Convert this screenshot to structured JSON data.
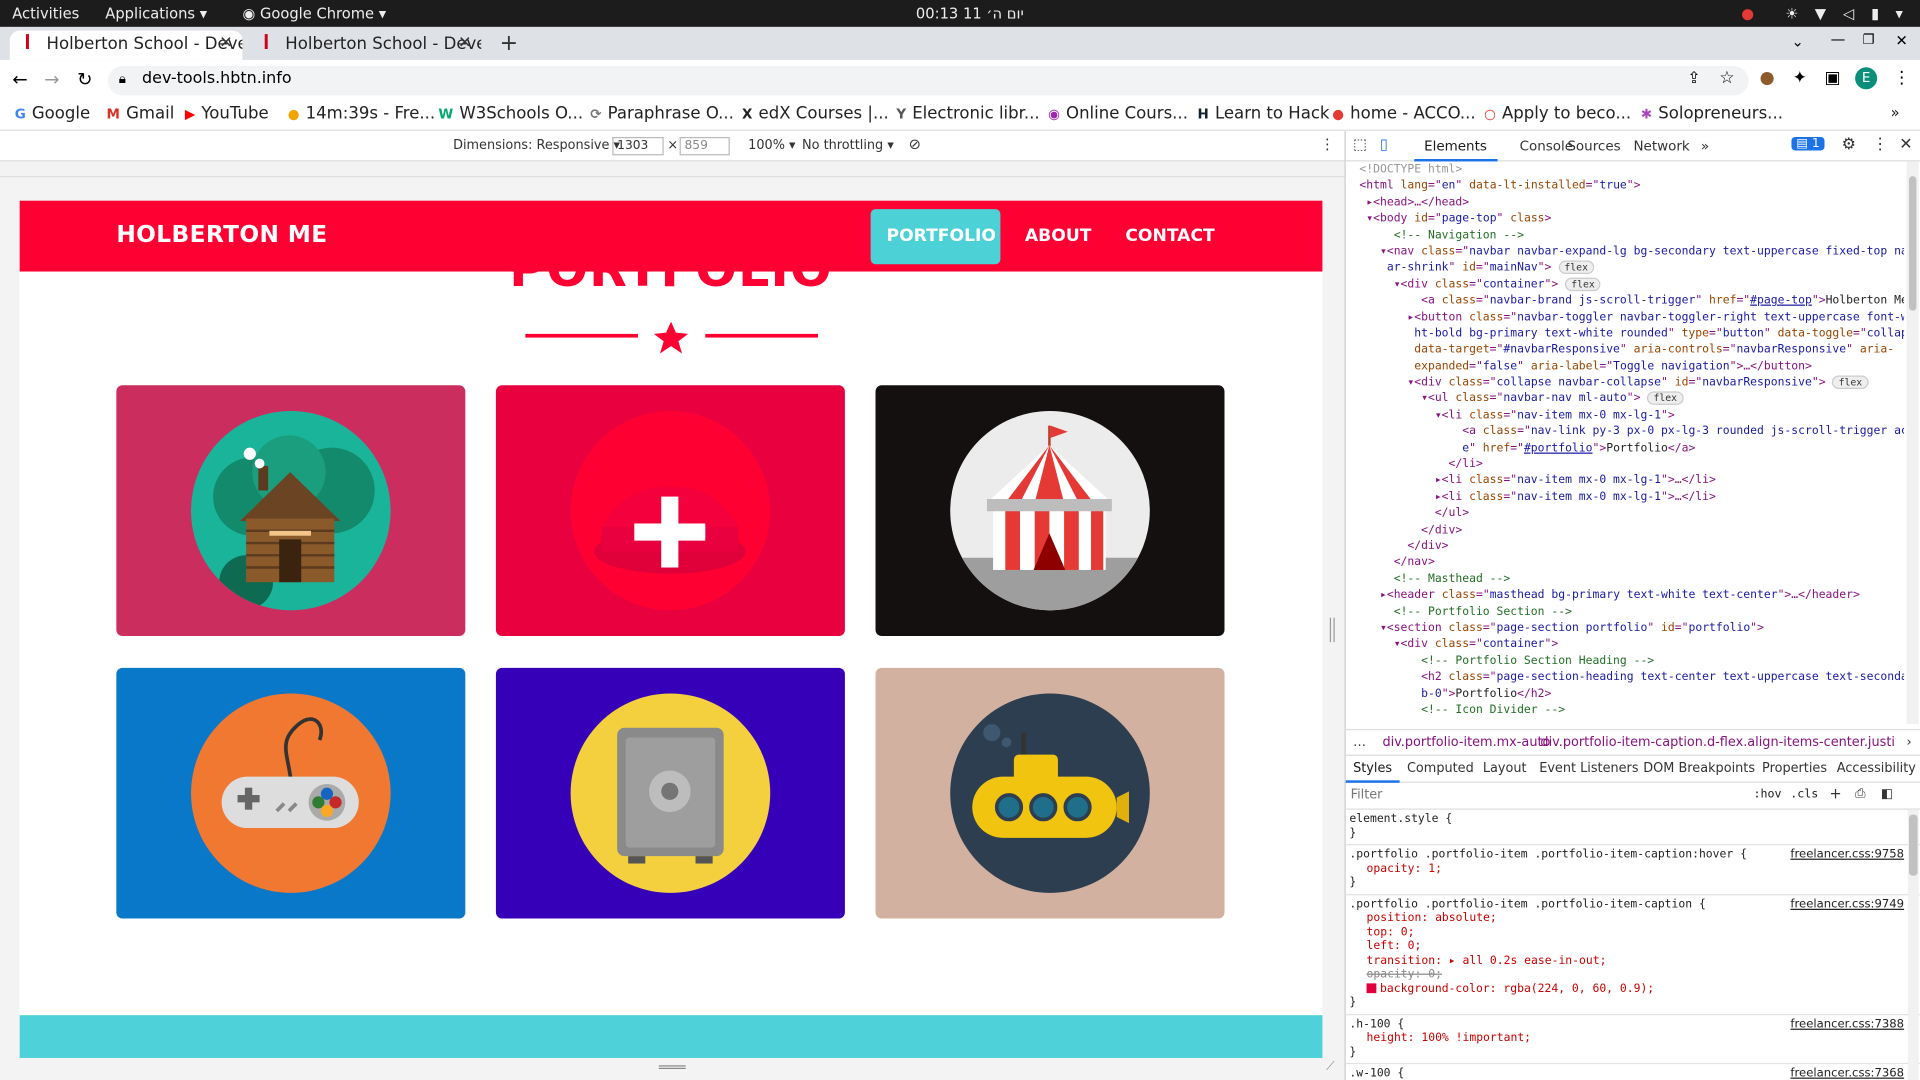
{
  "system_bar": {
    "activities": "Activities",
    "applications": "Applications",
    "browser_app": "Google Chrome",
    "clock": "יום ה׳ 11 00:13"
  },
  "browser": {
    "tabs": [
      {
        "title": "Holberton School - Deve"
      },
      {
        "title": "Holberton School - Deve"
      }
    ],
    "url": "dev-tools.hbtn.info",
    "profile_initial": "E",
    "bookmarks": [
      "Google",
      "Gmail",
      "YouTube",
      "14m:39s - Fre...",
      "W3Schools O...",
      "Paraphrase O...",
      "edX Courses |...",
      "Electronic libr...",
      "Online Cours...",
      "Learn to Hack",
      "home - ACCO...",
      "Apply to beco...",
      "Solopreneurs..."
    ]
  },
  "device_toolbar": {
    "dimensions": "Dimensions: Responsive",
    "width": "1303",
    "height": "859",
    "zoom": "100%",
    "throttling": "No throttling"
  },
  "site": {
    "brand": "HOLBERTON ME",
    "nav": [
      "PORTFOLIO",
      "ABOUT",
      "CONTACT"
    ],
    "active_nav": "PORTFOLIO",
    "section_title": "PORTFOLIO",
    "colors": {
      "primary": "#ff0033",
      "secondary": "#4cd1d6"
    },
    "portfolio": [
      {
        "icon": "cabin-icon",
        "bg": "#cc2d5f",
        "circle": "#19b49a"
      },
      {
        "icon": "cake-icon",
        "bg": "#e8003f",
        "circle": "#ff0033"
      },
      {
        "icon": "circus-tent-icon",
        "bg": "#141010",
        "circle": "#ececec"
      },
      {
        "icon": "game-controller-icon",
        "bg": "#0a78c8",
        "circle": "#f07830"
      },
      {
        "icon": "safe-icon",
        "bg": "#3600b8",
        "circle": "#f4d03f"
      },
      {
        "icon": "submarine-icon",
        "bg": "#d2b1a1",
        "circle": "#2c3e50"
      }
    ]
  },
  "devtools": {
    "tabs": [
      "Elements",
      "Console",
      "Sources",
      "Network"
    ],
    "issues_count": "1",
    "breadcrumbs": [
      "div.portfolio-item.mx-auto",
      "div.portfolio-item-caption.d-flex.align-items-center.justify-conter"
    ],
    "style_tabs": [
      "Styles",
      "Computed",
      "Layout",
      "Event Listeners",
      "DOM Breakpoints",
      "Properties",
      "Accessibility"
    ],
    "filter_placeholder": "Filter",
    "filter_hov": ":hov",
    "filter_cls": ".cls",
    "styles": {
      "element_style": "element.style {",
      "rule1_selector": ".portfolio .portfolio-item .portfolio-item-caption:hover {",
      "rule1_source": "freelancer.css:9758",
      "rule1_decl": "opacity: 1;",
      "rule2_selector": ".portfolio .portfolio-item .portfolio-item-caption {",
      "rule2_source": "freelancer.css:9749",
      "rule2_decls": [
        "position: absolute;",
        "top: 0;",
        "left: 0;",
        "transition: ▸ all 0.2s ease-in-out;",
        "opacity: 0;",
        "background-color: rgba(224, 0, 60, 0.9);"
      ],
      "rule3_selector": ".h-100 {",
      "rule3_source": "freelancer.css:7388",
      "rule3_decl": "height: 100% !important;",
      "rule4_selector": ".w-100 {",
      "rule4_source": "freelancer.css:7368"
    }
  }
}
